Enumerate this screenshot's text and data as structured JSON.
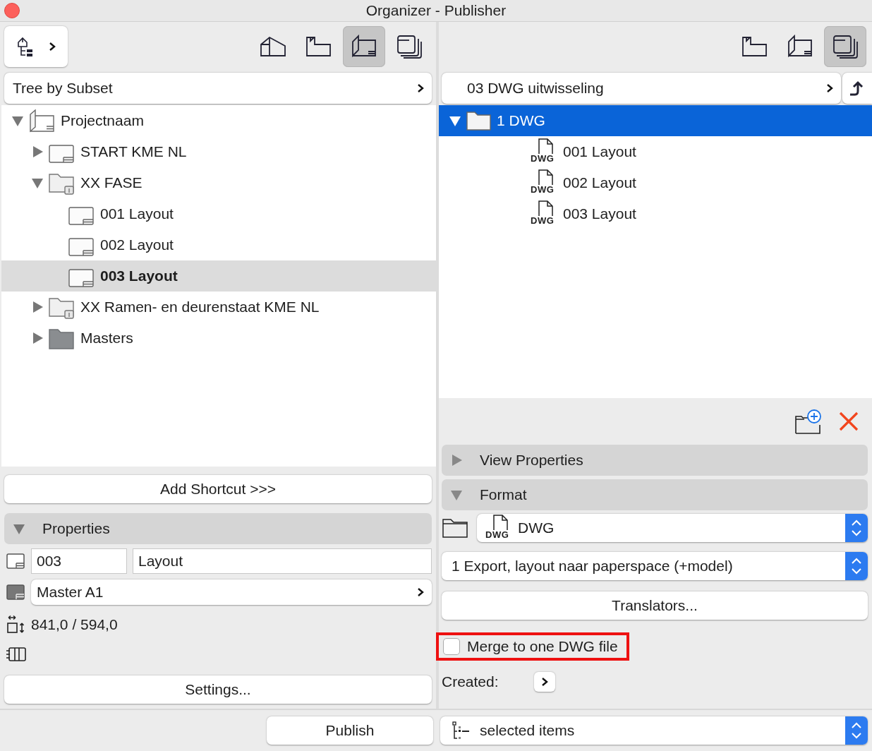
{
  "window": {
    "title": "Organizer - Publisher"
  },
  "left": {
    "view_buttons": [
      {
        "kind": "project-map",
        "selected": false
      },
      {
        "kind": "view-map",
        "selected": false
      },
      {
        "kind": "layout-book",
        "selected": true
      },
      {
        "kind": "publisher-sets",
        "selected": false
      }
    ],
    "subset_selector": "Tree by Subset",
    "tree": [
      {
        "label": "Projectnaam",
        "kind": "book",
        "expanded": true,
        "selected": false,
        "children": [
          {
            "label": "START KME NL",
            "kind": "layout",
            "expanded": false,
            "selected": false
          },
          {
            "label": "XX FASE",
            "kind": "subset",
            "expanded": true,
            "selected": false,
            "children": [
              {
                "label": "001 Layout",
                "kind": "layout",
                "selected": false
              },
              {
                "label": "002 Layout",
                "kind": "layout",
                "selected": false
              },
              {
                "label": "003 Layout",
                "kind": "layout",
                "selected": true
              }
            ]
          },
          {
            "label": "XX Ramen- en deurenstaat KME NL",
            "kind": "subset",
            "expanded": false,
            "selected": false
          },
          {
            "label": "Masters",
            "kind": "masters",
            "expanded": false,
            "selected": false
          }
        ]
      }
    ],
    "add_shortcut_button": "Add Shortcut >>>",
    "properties": {
      "title": "Properties",
      "expanded": true,
      "id": "003",
      "name": "Layout",
      "master": "Master A1",
      "size": "841,0 / 594,0",
      "settings_button": "Settings..."
    }
  },
  "right": {
    "view_buttons": [
      {
        "kind": "view-map",
        "selected": false
      },
      {
        "kind": "layout-book",
        "selected": false
      },
      {
        "kind": "publisher-sets",
        "selected": true
      }
    ],
    "set_selector": "03 DWG uitwisseling",
    "tree": [
      {
        "label": "1 DWG",
        "kind": "folder",
        "expanded": true,
        "selected": true,
        "children": [
          {
            "label": "001 Layout",
            "kind": "dwg",
            "badge": "DWG",
            "selected": false
          },
          {
            "label": "002 Layout",
            "kind": "dwg",
            "badge": "DWG",
            "selected": false
          },
          {
            "label": "003 Layout",
            "kind": "dwg",
            "badge": "DWG",
            "selected": false
          }
        ]
      }
    ],
    "sections": [
      {
        "title": "View Properties",
        "expanded": false
      },
      {
        "title": "Format",
        "expanded": true
      }
    ],
    "format": {
      "badge": "DWG",
      "value": "DWG"
    },
    "translator": "1 Export, layout naar paperspace (+model)",
    "translators_button": "Translators...",
    "merge": {
      "label": "Merge to one DWG file",
      "checked": false,
      "highlighted": true
    },
    "created_label": "Created:"
  },
  "bottom": {
    "publish_button": "Publish",
    "scope": "selected items"
  }
}
